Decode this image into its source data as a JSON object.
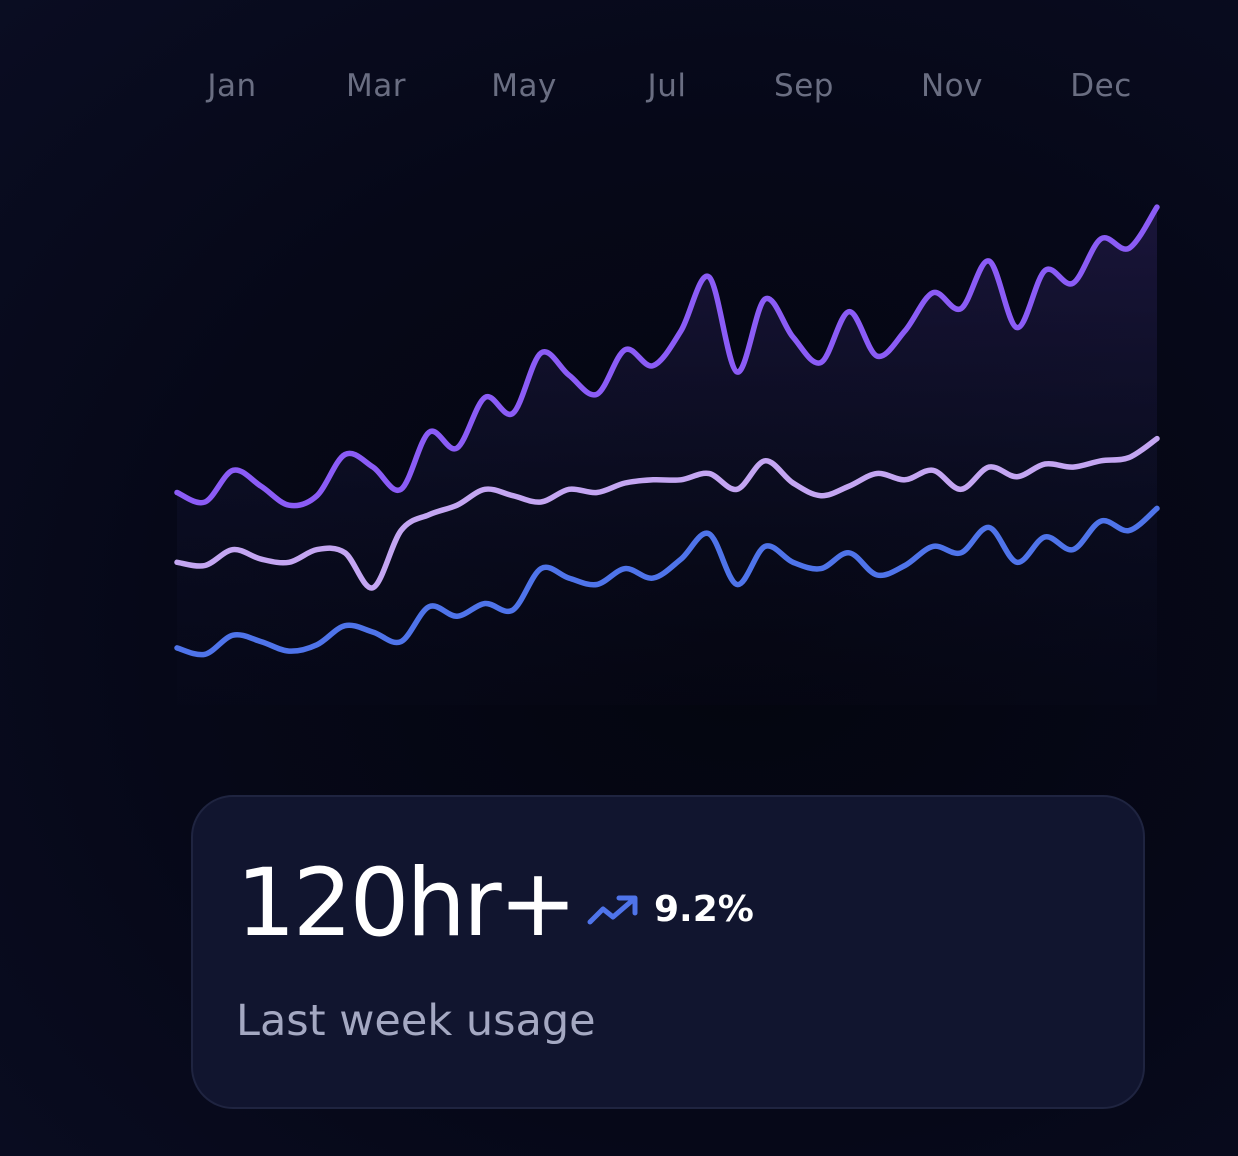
{
  "chart_data": {
    "type": "line",
    "categories": [
      "Jan",
      "Mar",
      "May",
      "Jul",
      "Sep",
      "Nov",
      "Dec"
    ],
    "series": [
      {
        "color": "#8b5cf6",
        "values": [
          5.2,
          4.9,
          5.9,
          5.4,
          4.8,
          5.1,
          6.4,
          6.0,
          5.3,
          7.1,
          6.6,
          8.2,
          7.7,
          9.6,
          8.9,
          8.3,
          9.7,
          9.2,
          10.3,
          12.0,
          9.0,
          11.3,
          10.1,
          9.3,
          10.9,
          9.5,
          10.3,
          11.5,
          11.0,
          12.5,
          10.4,
          12.2,
          11.8,
          13.2,
          12.9,
          14.2
        ]
      },
      {
        "color": "#c4a6f2",
        "values": [
          3.0,
          2.9,
          3.4,
          3.1,
          3.0,
          3.4,
          3.3,
          2.2,
          4.0,
          4.5,
          4.8,
          5.3,
          5.1,
          4.9,
          5.3,
          5.2,
          5.5,
          5.6,
          5.6,
          5.8,
          5.3,
          6.2,
          5.5,
          5.1,
          5.4,
          5.8,
          5.6,
          5.9,
          5.3,
          6.0,
          5.7,
          6.1,
          6.0,
          6.2,
          6.3,
          6.9
        ]
      },
      {
        "color": "#4f74ea",
        "values": [
          0.3,
          0.1,
          0.7,
          0.5,
          0.2,
          0.4,
          1.0,
          0.8,
          0.5,
          1.6,
          1.3,
          1.7,
          1.5,
          2.8,
          2.5,
          2.3,
          2.8,
          2.5,
          3.1,
          3.9,
          2.3,
          3.5,
          3.0,
          2.8,
          3.3,
          2.6,
          2.9,
          3.5,
          3.3,
          4.1,
          3.0,
          3.8,
          3.4,
          4.3,
          4.0,
          4.7
        ]
      }
    ],
    "ylim": [
      -1.5,
      16
    ],
    "grid": false,
    "legend": "none"
  },
  "summary": {
    "value": "120hr+",
    "change": "9.2%",
    "change_icon": "trend-up-icon",
    "caption": "Last week usage"
  },
  "colors": {
    "background": "#060818",
    "card_background": "#11152f",
    "accent_blue": "#4f74ea"
  }
}
